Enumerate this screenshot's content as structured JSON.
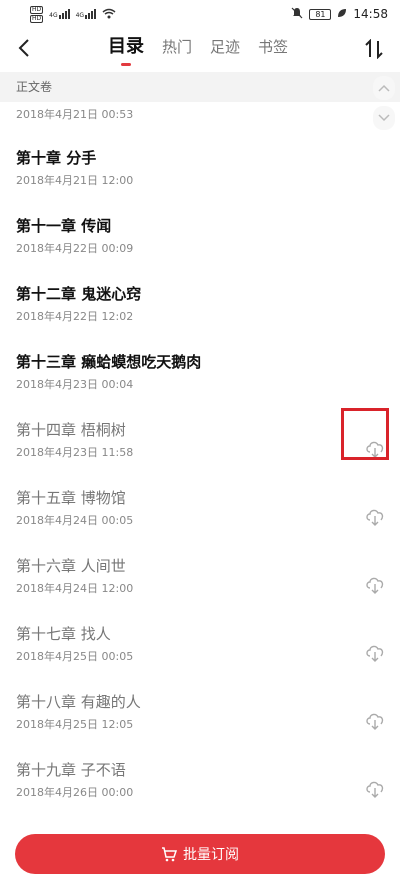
{
  "status": {
    "sim1": "HD",
    "sim2": "HD",
    "net1": "4G",
    "net2": "4G",
    "battery": "81",
    "time": "14:58",
    "icons": [
      "signal-icon",
      "wifi-icon",
      "mute-icon",
      "battery-icon",
      "leaf-icon"
    ]
  },
  "nav": {
    "tabs": [
      "目录",
      "热门",
      "足迹",
      "书签"
    ],
    "active_tab": "目录",
    "icons": [
      "back-arrow-icon",
      "sort-icon"
    ]
  },
  "volume": {
    "title": "正文卷"
  },
  "first_date": "2018年4月21日 00:53",
  "chapters": [
    {
      "title": "第十章 分手",
      "date": "2018年4月21日 12:00",
      "state": "read"
    },
    {
      "title": "第十一章 传闻",
      "date": "2018年4月22日 00:09",
      "state": "read"
    },
    {
      "title": "第十二章 鬼迷心窍",
      "date": "2018年4月22日 12:02",
      "state": "read"
    },
    {
      "title": "第十三章 癞蛤蟆想吃天鹅肉",
      "date": "2018年4月23日 00:04",
      "state": "read"
    },
    {
      "title": "第十四章 梧桐树",
      "date": "2018年4月23日 11:58",
      "state": "locked"
    },
    {
      "title": "第十五章 博物馆",
      "date": "2018年4月24日 00:05",
      "state": "locked"
    },
    {
      "title": "第十六章 人间世",
      "date": "2018年4月24日 12:00",
      "state": "locked"
    },
    {
      "title": "第十七章 找人",
      "date": "2018年4月25日 00:05",
      "state": "locked"
    },
    {
      "title": "第十八章 有趣的人",
      "date": "2018年4月25日 12:05",
      "state": "locked"
    },
    {
      "title": "第十九章 子不语",
      "date": "2018年4月26日 00:00",
      "state": "locked"
    }
  ],
  "buy_button": {
    "label": "批量订阅",
    "icon": "cart-icon"
  },
  "colors": {
    "accent": "#e5373d",
    "highlight": "#d9232a"
  }
}
